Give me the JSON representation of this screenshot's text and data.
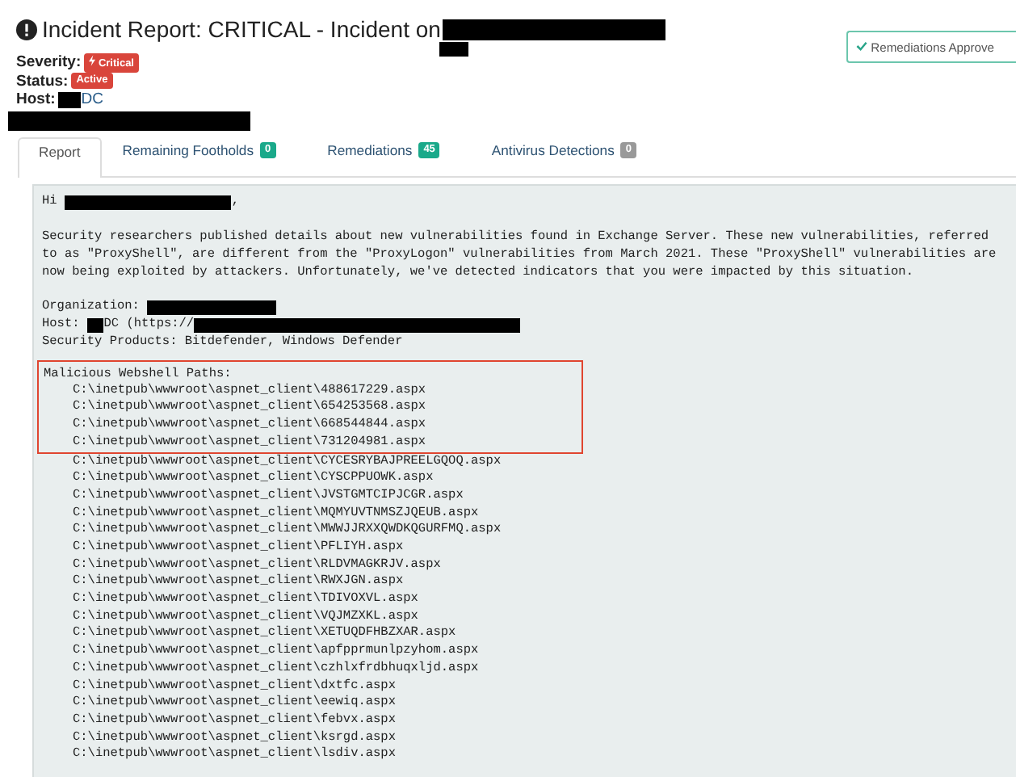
{
  "header": {
    "title": "Incident Report: CRITICAL - Incident on",
    "title_redacted": true,
    "subtitle_redacted": true,
    "severity": {
      "label": "Severity:",
      "badge": "Critical",
      "color": "#d9453b"
    },
    "status": {
      "label": "Status:",
      "badge": "Active",
      "color": "#d9453b"
    },
    "host": {
      "label": "Host:",
      "value": "DC",
      "redacted": true
    },
    "extra_redacted": true,
    "approve_button": "Remediations Approve"
  },
  "tabs": [
    {
      "label": "Report",
      "selected": true
    },
    {
      "label": "Remaining Footholds",
      "count": "0",
      "color": "#1aa98a",
      "selected": false
    },
    {
      "label": "Remediations",
      "count": "45",
      "color": "#1aa98a",
      "selected": false
    },
    {
      "label": "Antivirus Detections",
      "count": "0",
      "color": "#999999",
      "selected": false
    }
  ],
  "report": {
    "greeting": "Hi",
    "greeting_end": ",",
    "name_redacted": true,
    "body": "Security researchers published details about new vulnerabilities found in Exchange Server. These new vulnerabilities, referred to as \"ProxyShell\", are different from the \"ProxyLogon\" vulnerabilities from March 2021. These \"ProxyShell\" vulnerabilities are now being exploited by attackers. Unfortunately, we've detected indicators that you were impacted by this situation.",
    "organization": {
      "label": "Organization:",
      "redacted": true
    },
    "host": {
      "label": "Host:",
      "value": "DC (https://",
      "redacted": true
    },
    "products": "Security Products: Bitdefender, Windows Defender",
    "paths_heading": "Malicious Webshell Paths:",
    "paths": [
      {
        "text": "C:\\inetpub\\wwwroot\\aspnet_client\\488617229.aspx",
        "highlighted": true
      },
      {
        "text": "C:\\inetpub\\wwwroot\\aspnet_client\\654253568.aspx",
        "highlighted": true
      },
      {
        "text": "C:\\inetpub\\wwwroot\\aspnet_client\\668544844.aspx",
        "highlighted": true
      },
      {
        "text": "C:\\inetpub\\wwwroot\\aspnet_client\\731204981.aspx",
        "highlighted": true
      },
      {
        "text": "C:\\inetpub\\wwwroot\\aspnet_client\\CYCESRYBAJPREELGQOQ.aspx",
        "highlighted": false
      },
      {
        "text": "C:\\inetpub\\wwwroot\\aspnet_client\\CYSCPPUOWK.aspx",
        "highlighted": false
      },
      {
        "text": "C:\\inetpub\\wwwroot\\aspnet_client\\JVSTGMTCIPJCGR.aspx",
        "highlighted": false
      },
      {
        "text": "C:\\inetpub\\wwwroot\\aspnet_client\\MQMYUVTNMSZJQEUB.aspx",
        "highlighted": false
      },
      {
        "text": "C:\\inetpub\\wwwroot\\aspnet_client\\MWWJJRXXQWDKQGURFMQ.aspx",
        "highlighted": false
      },
      {
        "text": "C:\\inetpub\\wwwroot\\aspnet_client\\PFLIYH.aspx",
        "highlighted": false
      },
      {
        "text": "C:\\inetpub\\wwwroot\\aspnet_client\\RLDVMAGKRJV.aspx",
        "highlighted": false
      },
      {
        "text": "C:\\inetpub\\wwwroot\\aspnet_client\\RWXJGN.aspx",
        "highlighted": false
      },
      {
        "text": "C:\\inetpub\\wwwroot\\aspnet_client\\TDIVOXVL.aspx",
        "highlighted": false
      },
      {
        "text": "C:\\inetpub\\wwwroot\\aspnet_client\\VQJMZXKL.aspx",
        "highlighted": false
      },
      {
        "text": "C:\\inetpub\\wwwroot\\aspnet_client\\XETUQDFHBZXAR.aspx",
        "highlighted": false
      },
      {
        "text": "C:\\inetpub\\wwwroot\\aspnet_client\\apfpprmunlpzyhom.aspx",
        "highlighted": false
      },
      {
        "text": "C:\\inetpub\\wwwroot\\aspnet_client\\czhlxfrdbhuqxljd.aspx",
        "highlighted": false
      },
      {
        "text": "C:\\inetpub\\wwwroot\\aspnet_client\\dxtfc.aspx",
        "highlighted": false
      },
      {
        "text": "C:\\inetpub\\wwwroot\\aspnet_client\\eewiq.aspx",
        "highlighted": false
      },
      {
        "text": "C:\\inetpub\\wwwroot\\aspnet_client\\febvx.aspx",
        "highlighted": false
      },
      {
        "text": "C:\\inetpub\\wwwroot\\aspnet_client\\ksrgd.aspx",
        "highlighted": false
      },
      {
        "text": "C:\\inetpub\\wwwroot\\aspnet_client\\lsdiv.aspx",
        "highlighted": false
      }
    ]
  }
}
